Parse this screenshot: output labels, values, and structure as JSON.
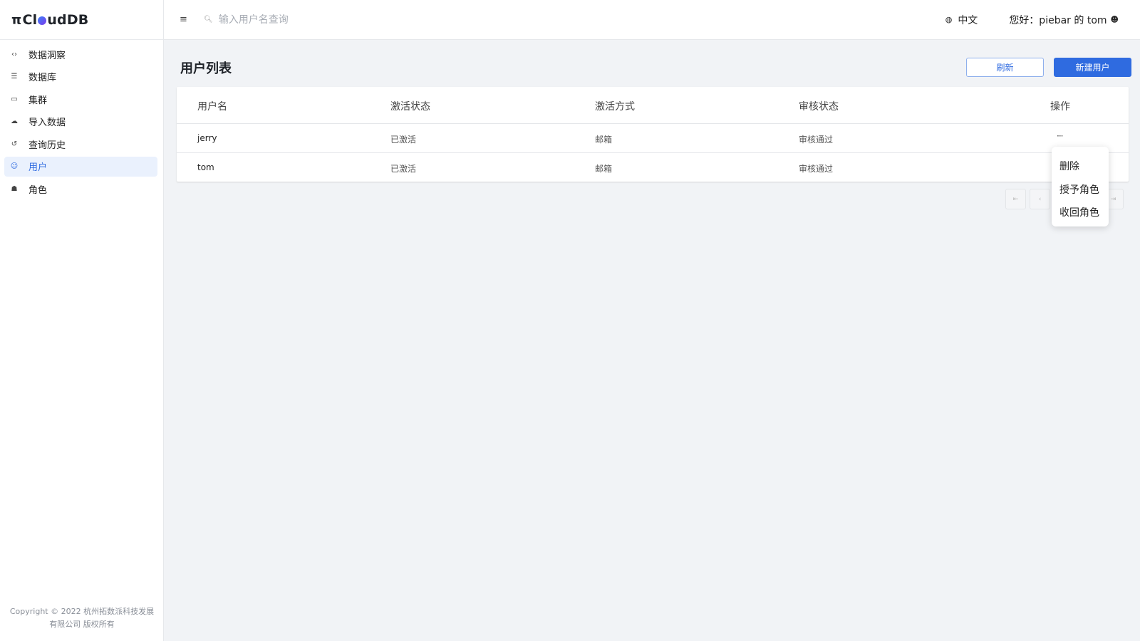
{
  "app": {
    "logo_prefix": "π",
    "logo_text_a": "Cl",
    "logo_text_b": "udDB"
  },
  "sidebar": {
    "items": [
      {
        "label": "数据洞察",
        "icon": "code-icon"
      },
      {
        "label": "数据库",
        "icon": "list-icon"
      },
      {
        "label": "集群",
        "icon": "laptop-icon"
      },
      {
        "label": "导入数据",
        "icon": "cloud-upload-icon"
      },
      {
        "label": "查询历史",
        "icon": "history-icon"
      },
      {
        "label": "用户",
        "icon": "user-icon",
        "active": true
      },
      {
        "label": "角色",
        "icon": "role-icon"
      }
    ],
    "copyright": "Copyright © 2022 杭州拓数派科技发展有限公司 版权所有"
  },
  "header": {
    "search_placeholder": "输入用户名查询",
    "language": "中文",
    "greeting": "您好：piebar 的 tom"
  },
  "main": {
    "title": "用户列表",
    "refresh_label": "刷新",
    "new_user_label": "新建用户",
    "table": {
      "columns": [
        "用户名",
        "激活状态",
        "激活方式",
        "审核状态",
        "操作"
      ],
      "rows": [
        {
          "username": "jerry",
          "activation_status": "已激活",
          "activation_method": "邮箱",
          "review_status": "审核通过",
          "action": "···"
        },
        {
          "username": "tom",
          "activation_status": "已激活",
          "activation_method": "邮箱",
          "review_status": "审核通过",
          "action": "···"
        }
      ]
    },
    "pagination": {
      "first": "⇤",
      "prev": "‹",
      "last": "⇥"
    },
    "action_menu": {
      "items": [
        "删除",
        "授予角色",
        "收回角色"
      ]
    }
  },
  "colors": {
    "accent": "#2f6be0",
    "active_bg": "#eaf1fd",
    "page_bg": "#f1f3f6"
  }
}
